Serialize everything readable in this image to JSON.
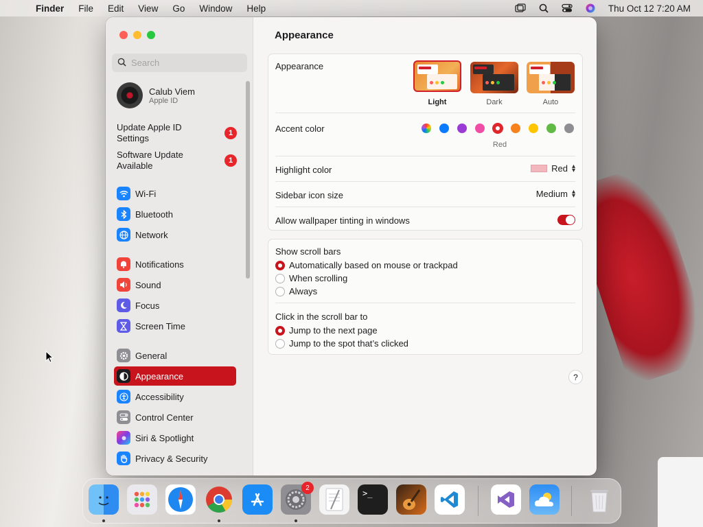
{
  "menubar": {
    "app_name": "Finder",
    "items": [
      "File",
      "Edit",
      "View",
      "Go",
      "Window",
      "Help"
    ],
    "clock": "Thu Oct 12  7:20 AM"
  },
  "window": {
    "title": "Appearance",
    "search_placeholder": "Search",
    "user": {
      "name": "Calub Viem",
      "subtitle": "Apple ID"
    },
    "notices": [
      {
        "label": "Update Apple ID Settings",
        "badge": "1"
      },
      {
        "label": "Software Update Available",
        "badge": "1"
      }
    ],
    "sidebar_items": [
      {
        "label": "Wi-Fi",
        "icon": "wifi-icon",
        "color": "#1a84ff"
      },
      {
        "label": "Bluetooth",
        "icon": "bluetooth-icon",
        "color": "#1a84ff"
      },
      {
        "label": "Network",
        "icon": "globe-icon",
        "color": "#1a84ff"
      },
      {
        "label": "Notifications",
        "icon": "bell-icon",
        "color": "#f0433a"
      },
      {
        "label": "Sound",
        "icon": "speaker-icon",
        "color": "#f0433a"
      },
      {
        "label": "Focus",
        "icon": "moon-icon",
        "color": "#5e5ce6"
      },
      {
        "label": "Screen Time",
        "icon": "hourglass-icon",
        "color": "#5e5ce6"
      },
      {
        "label": "General",
        "icon": "gear-icon",
        "color": "#8e8e93"
      },
      {
        "label": "Appearance",
        "icon": "appearance-icon",
        "color": "#1c1c1e"
      },
      {
        "label": "Accessibility",
        "icon": "accessibility-icon",
        "color": "#1a84ff"
      },
      {
        "label": "Control Center",
        "icon": "switches-icon",
        "color": "#8e8e93"
      },
      {
        "label": "Siri & Spotlight",
        "icon": "siri-icon",
        "color": "#7b3fe4"
      },
      {
        "label": "Privacy & Security",
        "icon": "hand-icon",
        "color": "#1a84ff"
      }
    ],
    "appearance": {
      "label": "Appearance",
      "options": [
        "Light",
        "Dark",
        "Auto"
      ],
      "selected": "Light"
    },
    "accent": {
      "label": "Accent color",
      "colors": [
        "multicolor",
        "#0a7aff",
        "#9a3bd6",
        "#f04ea6",
        "#e0262d",
        "#f7821b",
        "#ffc600",
        "#62ba46",
        "#8e8e93"
      ],
      "selected_name": "Red"
    },
    "highlight": {
      "label": "Highlight color",
      "value": "Red",
      "swatch": "#f3b8bd"
    },
    "sidebar_icon_size": {
      "label": "Sidebar icon size",
      "value": "Medium"
    },
    "wallpaper_tinting": {
      "label": "Allow wallpaper tinting in windows",
      "on": true
    },
    "scroll_bars": {
      "label": "Show scroll bars",
      "options": [
        "Automatically based on mouse or trackpad",
        "When scrolling",
        "Always"
      ],
      "selected": 0
    },
    "click_scroll": {
      "label": "Click in the scroll bar to",
      "options": [
        "Jump to the next page",
        "Jump to the spot that’s clicked"
      ],
      "selected": 0
    },
    "help": "?"
  },
  "dock": {
    "apps": [
      {
        "name": "finder",
        "color": "#2f8cf0"
      },
      {
        "name": "launchpad",
        "color": "#e9e9ee"
      },
      {
        "name": "safari",
        "color": "#1e88f0"
      },
      {
        "name": "chrome",
        "color": "#ffffff"
      },
      {
        "name": "app-store",
        "color": "#1b8cf6"
      },
      {
        "name": "system-settings",
        "color": "#8e8e93",
        "badge": "2"
      },
      {
        "name": "textedit",
        "color": "#f4f4f4"
      },
      {
        "name": "terminal",
        "color": "#1e1e1e"
      },
      {
        "name": "garageband",
        "color": "#d56a1a"
      },
      {
        "name": "vscode",
        "color": "#ffffff"
      },
      {
        "name": "visual-studio",
        "color": "#ffffff"
      },
      {
        "name": "weather",
        "color": "#3aa0f4"
      },
      {
        "name": "trash",
        "color": "#d9d9d9"
      }
    ]
  }
}
